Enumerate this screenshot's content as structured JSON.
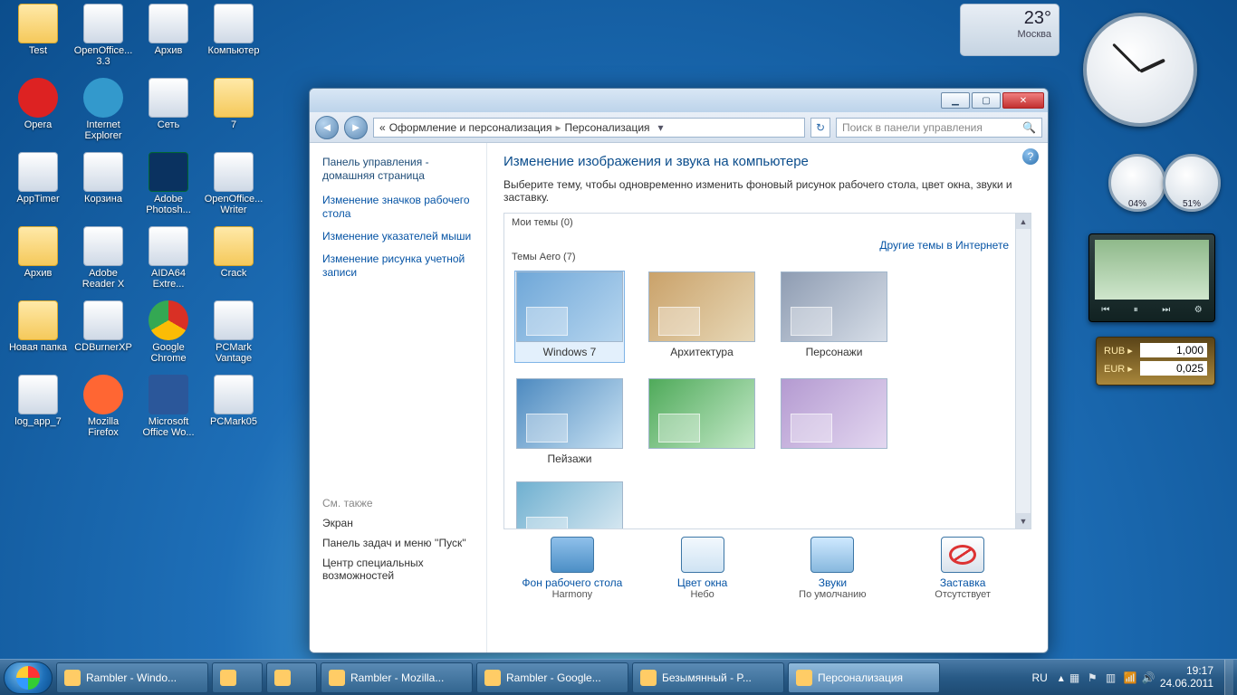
{
  "desktop_icons": [
    {
      "label": "Test",
      "k": "folder"
    },
    {
      "label": "OpenOffice... 3.3",
      "k": "generic"
    },
    {
      "label": "Архив",
      "k": "generic"
    },
    {
      "label": "Компьютер",
      "k": "generic"
    },
    {
      "label": "Opera",
      "k": "opera"
    },
    {
      "label": "Internet Explorer",
      "k": "ie"
    },
    {
      "label": "Сеть",
      "k": "generic"
    },
    {
      "label": "7",
      "k": "folder"
    },
    {
      "label": "AppTimer",
      "k": "generic"
    },
    {
      "label": "Корзина",
      "k": "generic"
    },
    {
      "label": "Adobe Photosh...",
      "k": "ps"
    },
    {
      "label": "OpenOffice... Writer",
      "k": "generic"
    },
    {
      "label": "Архив",
      "k": "folder"
    },
    {
      "label": "Adobe Reader X",
      "k": "generic"
    },
    {
      "label": "AIDA64 Extre...",
      "k": "generic"
    },
    {
      "label": "Crack",
      "k": "folder"
    },
    {
      "label": "Новая папка",
      "k": "folder"
    },
    {
      "label": "CDBurnerXP",
      "k": "generic"
    },
    {
      "label": "Google Chrome",
      "k": "chrome"
    },
    {
      "label": "PCMark Vantage",
      "k": "generic"
    },
    {
      "label": "log_app_7",
      "k": "generic"
    },
    {
      "label": "Mozilla Firefox",
      "k": "ff"
    },
    {
      "label": "Microsoft Office Wo...",
      "k": "word"
    },
    {
      "label": "PCMark05",
      "k": "generic"
    }
  ],
  "desktop_cols": 4,
  "desktop_col_w": 72,
  "desktop_row_h": 82,
  "window": {
    "breadcrumb": {
      "prefix": "«",
      "seg1": "Оформление и персонализация",
      "seg2": "Персонализация"
    },
    "search_placeholder": "Поиск в панели управления",
    "buttons": {
      "min": "▁",
      "max": "▢",
      "close": "✕"
    },
    "side": {
      "home": "Панель управления - домашняя страница",
      "links": [
        "Изменение значков рабочего стола",
        "Изменение указателей мыши",
        "Изменение рисунка учетной записи"
      ],
      "see_also": "См. также",
      "subs": [
        "Экран",
        "Панель задач и меню ''Пуск''",
        "Центр специальных возможностей"
      ]
    },
    "main": {
      "title": "Изменение изображения и звука на компьютере",
      "desc": "Выберите тему, чтобы одновременно изменить фоновый рисунок рабочего стола, цвет окна, звуки и заставку.",
      "my_themes": "Мои темы (0)",
      "aero_themes": "Темы Aero (7)",
      "online": "Другие темы в Интернете",
      "themes": [
        {
          "name": "Windows 7",
          "cls": "",
          "sel": true
        },
        {
          "name": "Архитектура",
          "cls": "t-arch",
          "sel": false
        },
        {
          "name": "Персонажи",
          "cls": "t-char",
          "sel": false
        },
        {
          "name": "Пейзажи",
          "cls": "t-land",
          "sel": false
        },
        {
          "name": "",
          "cls": "t-nat",
          "sel": false
        },
        {
          "name": "",
          "cls": "t-scn",
          "sel": false
        },
        {
          "name": "",
          "cls": "t-usa",
          "sel": false
        }
      ],
      "bottom": {
        "bg": {
          "cap": "Фон рабочего стола",
          "val": "Harmony"
        },
        "color": {
          "cap": "Цвет окна",
          "val": "Небо"
        },
        "sound": {
          "cap": "Звуки",
          "val": "По умолчанию"
        },
        "saver": {
          "cap": "Заставка",
          "val": "Отсутствует"
        }
      }
    }
  },
  "gadgets": {
    "weather": {
      "temp": "23°",
      "city": "Москва"
    },
    "gauges": {
      "cpu": "04%",
      "ram": "51%"
    },
    "slideshow_ctrls": [
      "⏮",
      "⏸",
      "⏭",
      "⚙"
    ],
    "fx": [
      {
        "cur": "RUB ▸",
        "val": "1,000"
      },
      {
        "cur": "EUR ▸",
        "val": "0,025"
      }
    ]
  },
  "taskbar": {
    "items": [
      {
        "label": "Rambler - Windo...",
        "icon": "ie",
        "active": false
      },
      {
        "label": "",
        "icon": "explorer",
        "active": false
      },
      {
        "label": "",
        "icon": "wmp",
        "active": false
      },
      {
        "label": "Rambler - Mozilla...",
        "icon": "ff",
        "active": false
      },
      {
        "label": "Rambler - Google...",
        "icon": "chrome",
        "active": false
      },
      {
        "label": "Безымянный - P...",
        "icon": "paint",
        "active": false
      },
      {
        "label": "Персонализация",
        "icon": "cp",
        "active": true
      }
    ],
    "lang": "RU",
    "time": "19:17",
    "date": "24.06.2011"
  }
}
